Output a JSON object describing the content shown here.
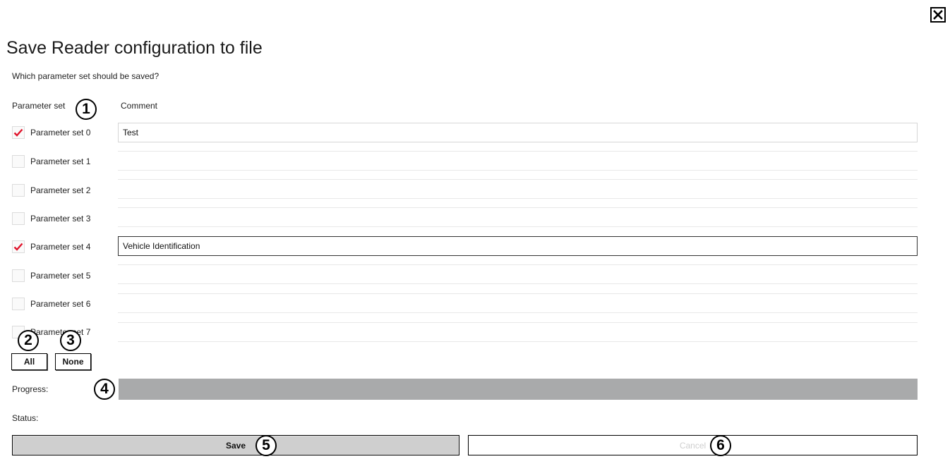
{
  "dialog": {
    "title": "Save Reader configuration to file",
    "question": "Which parameter set should be saved?",
    "close_icon": "close-x-icon"
  },
  "table": {
    "col_parameter_set": "Parameter set",
    "col_comment": "Comment",
    "rows": [
      {
        "label": "Parameter set 0",
        "checked": true,
        "comment": "Test"
      },
      {
        "label": "Parameter set 1",
        "checked": false,
        "comment": ""
      },
      {
        "label": "Parameter set 2",
        "checked": false,
        "comment": ""
      },
      {
        "label": "Parameter set 3",
        "checked": false,
        "comment": ""
      },
      {
        "label": "Parameter set 4",
        "checked": true,
        "comment": "Vehicle Identification"
      },
      {
        "label": "Parameter set 5",
        "checked": false,
        "comment": ""
      },
      {
        "label": "Parameter set 6",
        "checked": false,
        "comment": ""
      },
      {
        "label": "Parameter set 7",
        "checked": false,
        "comment": ""
      }
    ]
  },
  "buttons": {
    "all": "All",
    "none": "None",
    "save": "Save",
    "cancel": "Cancel"
  },
  "progress": {
    "label": "Progress:",
    "value_percent": 100
  },
  "status": {
    "label": "Status:",
    "text": ""
  },
  "callouts": [
    "1",
    "2",
    "3",
    "4",
    "5",
    "6"
  ],
  "colors": {
    "check_mark": "#e0152c",
    "progress_fill": "#a9aaab",
    "save_button_bg": "#cfcfcf",
    "cancel_text_disabled": "#cfcfcf"
  }
}
